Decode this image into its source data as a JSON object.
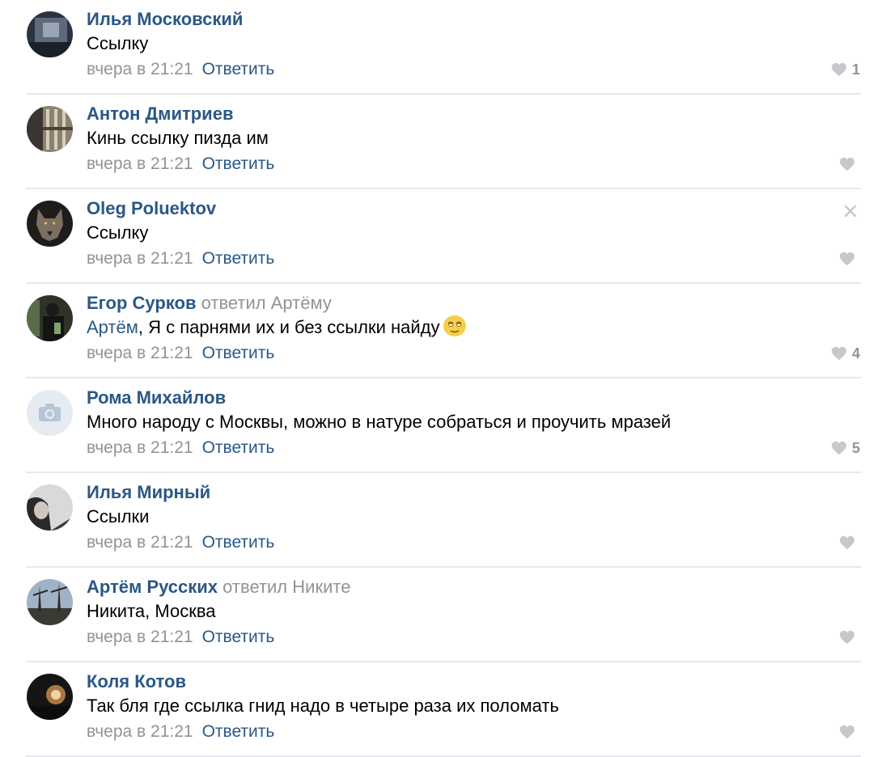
{
  "colors": {
    "author": "#2a5885",
    "meta": "#939393",
    "divider": "#e7e8ec",
    "like": "#c5c8cd"
  },
  "comments": [
    {
      "author": "Илья Московский",
      "text": "Ссылку",
      "date": "вчера в 21:21",
      "reply_label": "Ответить",
      "likes": "1",
      "avatar_icon": "avatar-photo"
    },
    {
      "author": "Антон Дмитриев",
      "text": "Кинь ссылку пизда им",
      "date": "вчера в 21:21",
      "reply_label": "Ответить",
      "likes": "",
      "avatar_icon": "avatar-photo"
    },
    {
      "author": "Oleg Poluektov",
      "text": "Ссылку",
      "date": "вчера в 21:21",
      "reply_label": "Ответить",
      "likes": "",
      "avatar_icon": "avatar-photo",
      "close_icon": "close-icon"
    },
    {
      "author": "Егор Сурков",
      "replied_label": "ответил",
      "replied_to": "Артёму",
      "mention": "Артём",
      "text": ", Я с парнями их и без ссылки найду",
      "emoji": "relieved-face-emoji",
      "date": "вчера в 21:21",
      "reply_label": "Ответить",
      "likes": "4",
      "avatar_icon": "avatar-photo"
    },
    {
      "author": "Рома Михайлов",
      "text": "Много народу с Москвы, можно в натуре собраться и проучить мразей",
      "date": "вчера в 21:21",
      "reply_label": "Ответить",
      "likes": "5",
      "avatar_icon": "camera-icon"
    },
    {
      "author": "Илья Мирный",
      "text": "Ссылки",
      "date": "вчера в 21:21",
      "reply_label": "Ответить",
      "likes": "",
      "avatar_icon": "avatar-photo"
    },
    {
      "author": "Артём Русских",
      "replied_label": "ответил",
      "replied_to": "Никите",
      "text": "Никита, Москва",
      "date": "вчера в 21:21",
      "reply_label": "Ответить",
      "likes": "",
      "avatar_icon": "avatar-photo"
    },
    {
      "author": "Коля Котов",
      "text": "Так бля где ссылка гнид надо в четыре раза их поломать",
      "date": "вчера в 21:21",
      "reply_label": "Ответить",
      "likes": "",
      "avatar_icon": "avatar-photo"
    }
  ]
}
